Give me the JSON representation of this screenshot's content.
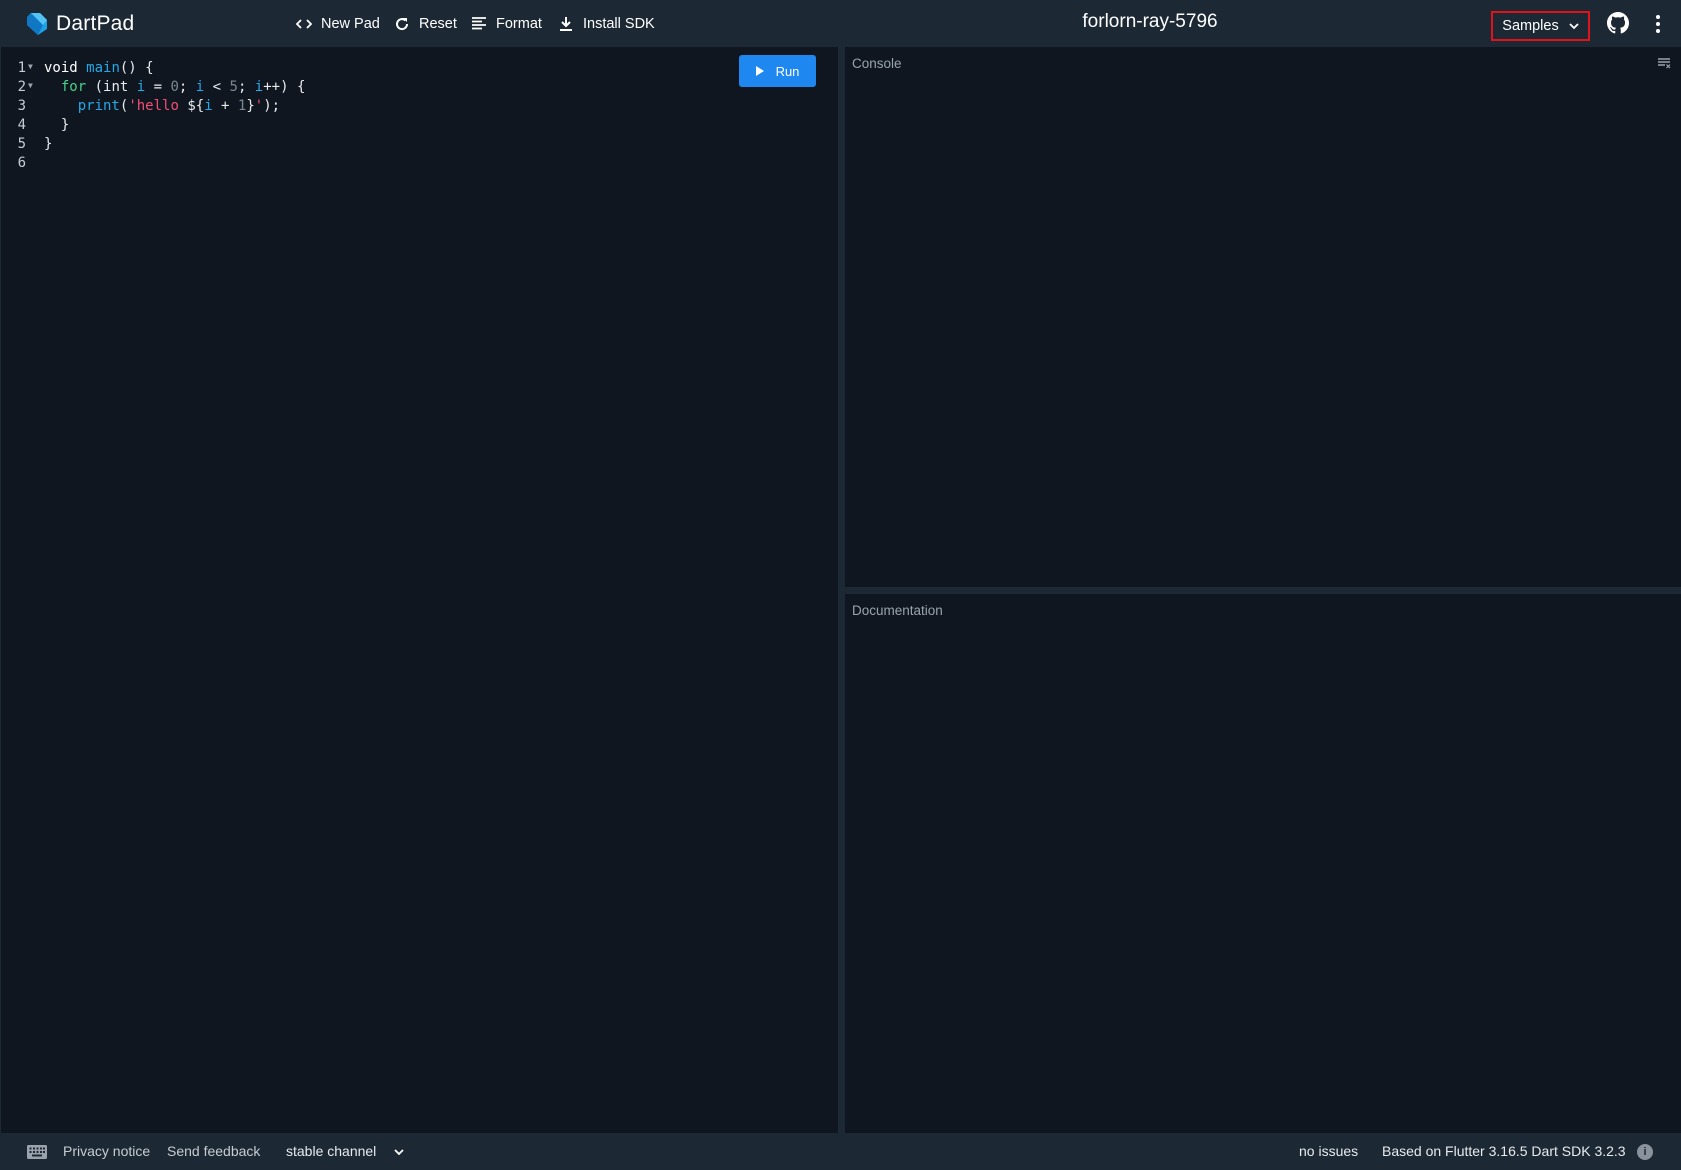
{
  "app": {
    "logo_text": "DartPad",
    "pad_name": "forlorn-ray-5796"
  },
  "toolbar": {
    "new_pad": {
      "label": "New Pad",
      "icon": "code-brackets-icon"
    },
    "reset": {
      "label": "Reset",
      "icon": "refresh-icon"
    },
    "format": {
      "label": "Format",
      "icon": "format-lines-icon"
    },
    "install_sdk": {
      "label": "Install SDK",
      "icon": "download-icon"
    },
    "samples": {
      "label": "Samples",
      "icon": "chevron-down-icon"
    },
    "github_icon": "github-icon",
    "more_icon": "more-vert-icon"
  },
  "editor": {
    "run_label": "Run",
    "line_numbers": [
      "1",
      "2",
      "3",
      "4",
      "5",
      "6"
    ],
    "lines": [
      [
        {
          "t": "kw",
          "v": "void "
        },
        {
          "t": "fn",
          "v": "main"
        },
        {
          "t": "src",
          "v": "() {"
        }
      ],
      [
        {
          "t": "src",
          "v": "  "
        },
        {
          "t": "ctl",
          "v": "for"
        },
        {
          "t": "src",
          "v": " (int "
        },
        {
          "t": "var",
          "v": "i"
        },
        {
          "t": "src",
          "v": " = "
        },
        {
          "t": "num",
          "v": "0"
        },
        {
          "t": "src",
          "v": "; "
        },
        {
          "t": "var",
          "v": "i"
        },
        {
          "t": "src",
          "v": " < "
        },
        {
          "t": "num",
          "v": "5"
        },
        {
          "t": "src",
          "v": "; "
        },
        {
          "t": "var",
          "v": "i"
        },
        {
          "t": "src",
          "v": "++) {"
        }
      ],
      [
        {
          "t": "src",
          "v": "    "
        },
        {
          "t": "fn",
          "v": "print"
        },
        {
          "t": "src",
          "v": "("
        },
        {
          "t": "str",
          "v": "'hello "
        },
        {
          "t": "src",
          "v": "${"
        },
        {
          "t": "var",
          "v": "i"
        },
        {
          "t": "src",
          "v": " + "
        },
        {
          "t": "num",
          "v": "1"
        },
        {
          "t": "src",
          "v": "}"
        },
        {
          "t": "str",
          "v": "'"
        },
        {
          "t": "src",
          "v": ");"
        }
      ],
      [
        {
          "t": "src",
          "v": "  }"
        }
      ],
      [
        {
          "t": "src",
          "v": "}"
        }
      ],
      [
        {
          "t": "src",
          "v": ""
        }
      ]
    ],
    "foldable_lines": [
      1,
      2
    ]
  },
  "console": {
    "label": "Console",
    "clear_icon": "clear-console-icon"
  },
  "documentation": {
    "label": "Documentation"
  },
  "footer": {
    "keyboard_icon": "keyboard-icon",
    "privacy": "Privacy notice",
    "feedback": "Send feedback",
    "channel": "stable channel",
    "issues": "no issues",
    "version": "Based on Flutter 3.16.5 Dart SDK 3.2.3",
    "info_icon": "info-icon"
  },
  "colors": {
    "header_bg": "#1c2834",
    "editor_bg": "#0f1620",
    "run_button": "#1e88f0",
    "samples_highlight": "#e3111a"
  }
}
